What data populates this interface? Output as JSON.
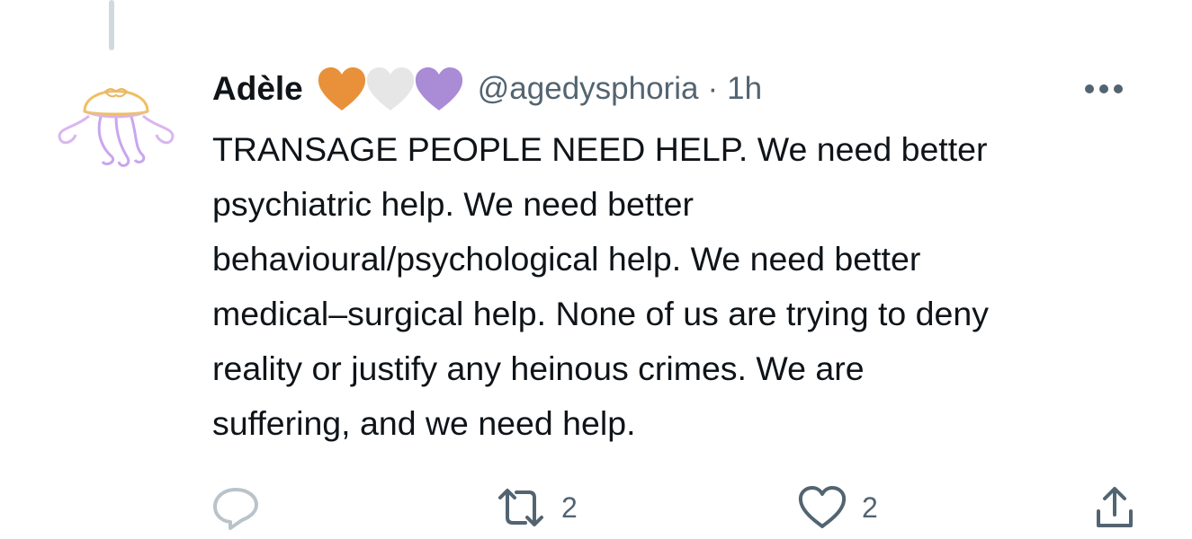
{
  "tweet": {
    "display_name": "Adèle",
    "badges": [
      {
        "icon": "orange-heart-icon",
        "color": "#e8913a"
      },
      {
        "icon": "white-heart-icon",
        "color": "#e6e6e6"
      },
      {
        "icon": "purple-heart-icon",
        "color": "#a98bd6"
      }
    ],
    "handle": "@agedysphoria",
    "separator": "·",
    "time": "1h",
    "text_lines": [
      "TRANSAGE PEOPLE NEED HELP. We need better",
      "psychiatric help. We need better",
      "behavioural/psychological help. We need better",
      "medical–surgical help. None of us are trying to deny",
      "reality or justify any heinous crimes. We are",
      "suffering, and we need help."
    ]
  },
  "actions": {
    "reply": {
      "icon": "reply-icon",
      "count": ""
    },
    "retweet": {
      "icon": "retweet-icon",
      "count": "2"
    },
    "like": {
      "icon": "like-icon",
      "count": "2"
    },
    "share": {
      "icon": "share-icon"
    }
  },
  "colors": {
    "text": "#0f1419",
    "secondary": "#536471",
    "thread_line": "#cfd9de",
    "icon_light": "#b9c3c9"
  }
}
